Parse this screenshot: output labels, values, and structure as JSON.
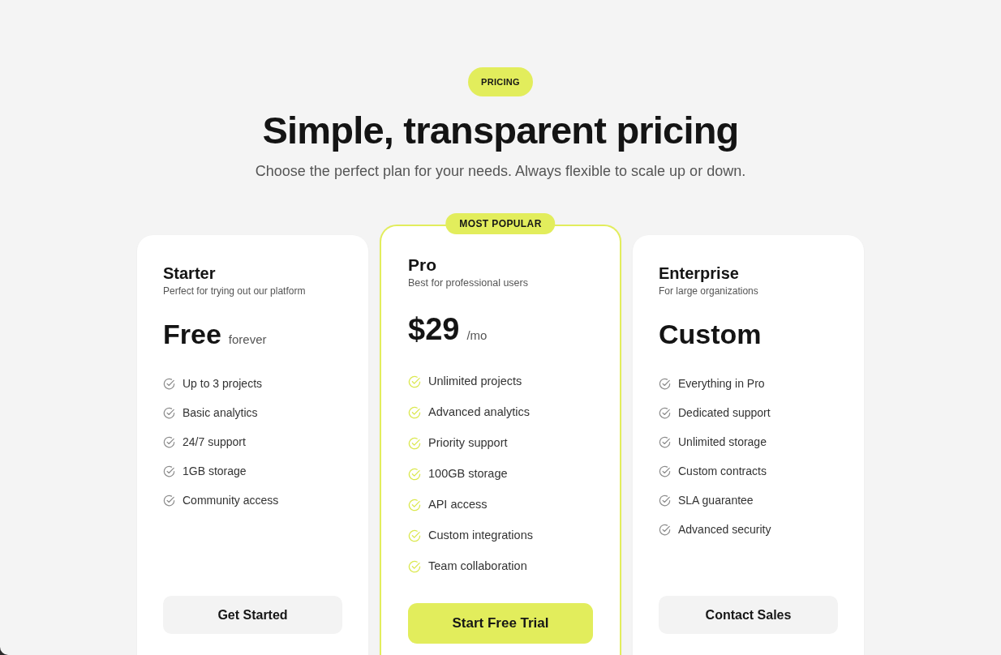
{
  "header": {
    "tag": "PRICING",
    "title": "Simple, transparent pricing",
    "subtitle": "Choose the perfect plan for your needs. Always flexible to scale up or down."
  },
  "plans": [
    {
      "name": "Starter",
      "description": "Perfect for trying out our platform",
      "price": "Free",
      "period": "forever",
      "featured": false,
      "features": [
        "Up to 3 projects",
        "Basic analytics",
        "24/7 support",
        "1GB storage",
        "Community access"
      ],
      "button": "Get Started"
    },
    {
      "name": "Pro",
      "description": "Best for professional users",
      "price": "$29",
      "period": "/mo",
      "featured": true,
      "badge": "MOST POPULAR",
      "features": [
        "Unlimited projects",
        "Advanced analytics",
        "Priority support",
        "100GB storage",
        "API access",
        "Custom integrations",
        "Team collaboration"
      ],
      "button": "Start Free Trial"
    },
    {
      "name": "Enterprise",
      "description": "For large organizations",
      "price": "Custom",
      "featured": false,
      "features": [
        "Everything in Pro",
        "Dedicated support",
        "Unlimited storage",
        "Custom contracts",
        "SLA guarantee",
        "Advanced security"
      ],
      "button": "Contact Sales"
    }
  ]
}
